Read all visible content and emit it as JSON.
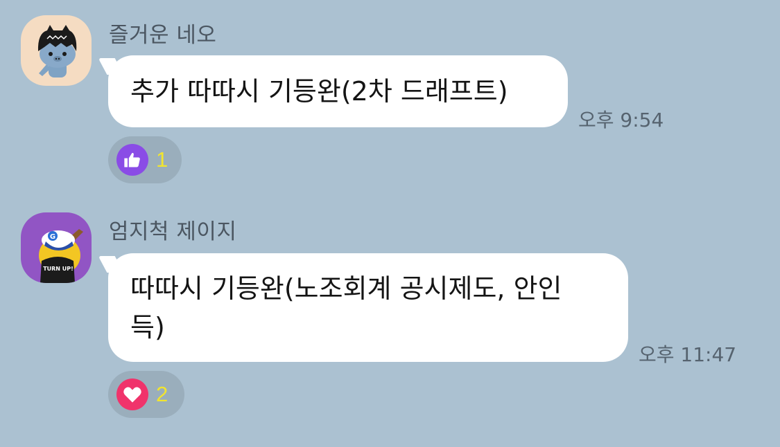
{
  "messages": [
    {
      "sender": "즐거운 네오",
      "avatar_icon": "neo-character-icon",
      "text": "추가 따따시 기등완(2차 드래프트)",
      "time": "오후 9:54",
      "reaction": {
        "icon": "thumbs-up-icon",
        "color": "#8a4ce6",
        "count": "1"
      }
    },
    {
      "sender": "엄지척 제이지",
      "avatar_icon": "jay-g-character-icon",
      "text_line1": "따따시 기등완(노조회계 공시제도, 안인",
      "text_line2": "득)",
      "time": "오후 11:47",
      "avatar_shirt_text": "TURN UP!",
      "reaction": {
        "icon": "heart-icon",
        "color": "#f0336b",
        "count": "2"
      }
    }
  ],
  "colors": {
    "background": "#abc1d1",
    "bubble": "#ffffff",
    "reaction_count": "#f2e52e"
  }
}
